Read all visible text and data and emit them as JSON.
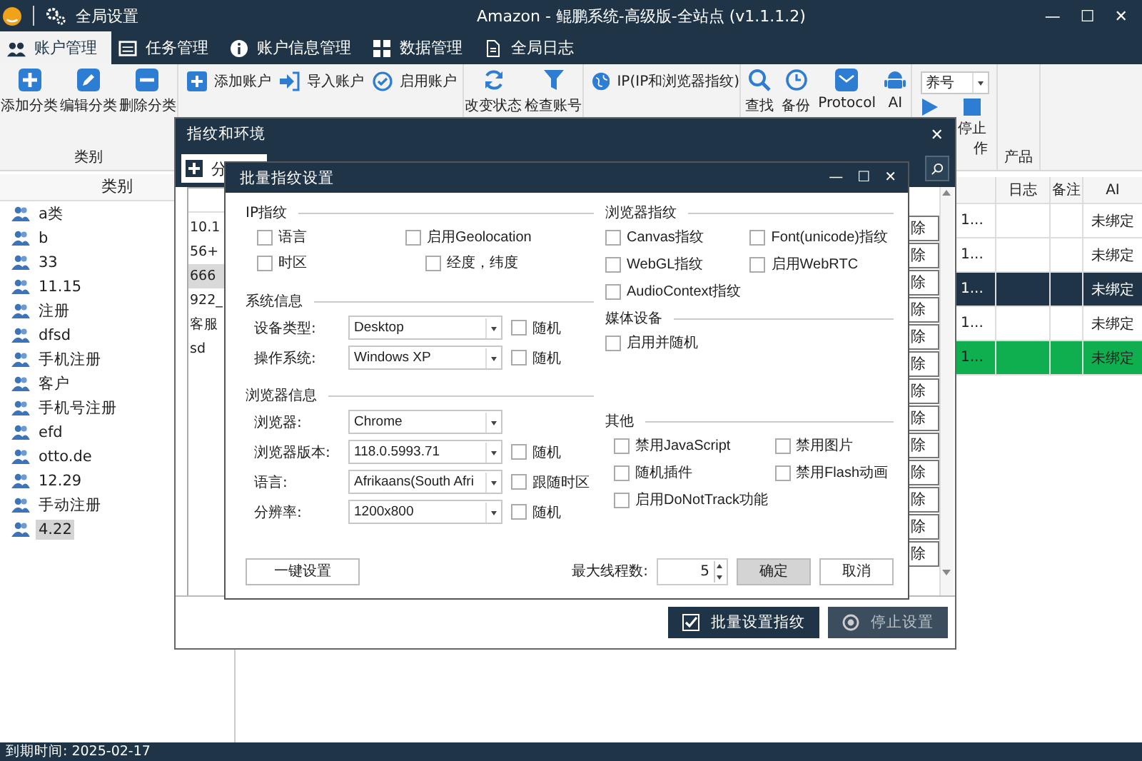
{
  "app": {
    "global_settings": "全局设置",
    "title": "Amazon - 鲲鹏系统-高级版-全站点  (v1.1.1.2)",
    "controls": [
      "—",
      "☐",
      "✕"
    ]
  },
  "tabs": [
    {
      "label": "账户管理",
      "selected": true
    },
    {
      "label": "任务管理",
      "selected": false
    },
    {
      "label": "账户信息管理",
      "selected": false
    },
    {
      "label": "数据管理",
      "selected": false
    },
    {
      "label": "全局日志",
      "selected": false
    }
  ],
  "ribbon": {
    "category_buttons": [
      "添加分类",
      "编辑分类",
      "删除分类"
    ],
    "category_group": "类别",
    "account_buttons": [
      "添加账户",
      "导入账户",
      "启用账户"
    ],
    "status_buttons": [
      "改变状态",
      "检查账号"
    ],
    "ip_button": "IP(IP和浏览器指纹)",
    "tool_buttons": [
      "查找",
      "备份",
      "Protocol",
      "AI"
    ],
    "mode_select": "养号",
    "stop_button": "停止",
    "operate_group": "作",
    "product_group": "产品"
  },
  "categories": {
    "header": "类别",
    "items": [
      {
        "label": "a类",
        "selected": false
      },
      {
        "label": "b",
        "selected": false
      },
      {
        "label": "33",
        "selected": false
      },
      {
        "label": "11.15",
        "selected": false
      },
      {
        "label": "注册",
        "selected": false
      },
      {
        "label": "dfsd",
        "selected": false
      },
      {
        "label": "手机注册",
        "selected": false
      },
      {
        "label": "客户",
        "selected": false
      },
      {
        "label": "手机号注册",
        "selected": false
      },
      {
        "label": "efd",
        "selected": false
      },
      {
        "label": "otto.de",
        "selected": false
      },
      {
        "label": "12.29",
        "selected": false
      },
      {
        "label": "手动注册",
        "selected": false
      },
      {
        "label": "4.22",
        "selected": true
      }
    ]
  },
  "accounts_table": {
    "columns": [
      "日志",
      "备注",
      "AI"
    ],
    "rows": [
      {
        "cell": "1...",
        "ai": "未绑定",
        "selected": false,
        "color": "#ffffff"
      },
      {
        "cell": "1...",
        "ai": "未绑定",
        "selected": false,
        "color": "#ffffff"
      },
      {
        "cell": "1...",
        "ai": "未绑定",
        "selected": true
      },
      {
        "cell": "1...",
        "ai": "未绑定",
        "selected": false,
        "color": "#ffffff"
      },
      {
        "cell": "1...",
        "ai": "未绑定",
        "selected": false,
        "color": "#0fae4f"
      }
    ]
  },
  "fingerprint_dialog": {
    "title": "指纹和环境",
    "close": "✕",
    "toolbar_button": "分",
    "groups": [
      {
        "label": "10.1",
        "selected": false
      },
      {
        "label": "56+",
        "selected": false
      },
      {
        "label": "666",
        "selected": true
      },
      {
        "label": "922_",
        "selected": false
      },
      {
        "label": "客服",
        "selected": false
      },
      {
        "label": "sd",
        "selected": false
      }
    ],
    "delete_buttons": [
      "除",
      "除",
      "除",
      "除",
      "除",
      "除",
      "除",
      "除",
      "除",
      "除",
      "除",
      "除",
      "除"
    ],
    "actions": [
      {
        "label": "批量设置指纹",
        "disabled": false
      },
      {
        "label": "停止设置",
        "disabled": true
      }
    ]
  },
  "batch_dialog": {
    "title": "批量指纹设置",
    "controls": [
      "—",
      "☐",
      "✕"
    ],
    "ip_section": {
      "title": "IP指纹",
      "options": [
        {
          "label": "语言",
          "checked": false
        },
        {
          "label": "启用Geolocation",
          "checked": false
        },
        {
          "label": "时区",
          "checked": false
        },
        {
          "label": "经度，纬度",
          "checked": false
        }
      ]
    },
    "system_section": {
      "title": "系统信息",
      "fields": [
        {
          "label": "设备类型:",
          "value": "Desktop",
          "option": {
            "label": "随机",
            "checked": false
          }
        },
        {
          "label": "操作系统:",
          "value": "Windows XP",
          "option": {
            "label": "随机",
            "checked": false
          }
        }
      ]
    },
    "browser_section": {
      "title": "浏览器信息",
      "fields": [
        {
          "label": "浏览器:",
          "value": "Chrome"
        },
        {
          "label": "浏览器版本:",
          "value": "118.0.5993.71",
          "option": {
            "label": "随机",
            "checked": false
          }
        },
        {
          "label": "语言:",
          "value": "Afrikaans(South Afri",
          "option": {
            "label": "跟随时区",
            "checked": false
          }
        },
        {
          "label": "分辨率:",
          "value": "1200x800",
          "option": {
            "label": "随机",
            "checked": false
          }
        }
      ]
    },
    "fingerprint_section": {
      "title": "浏览器指纹",
      "options": [
        {
          "label": "Canvas指纹",
          "checked": false
        },
        {
          "label": "Font(unicode)指纹",
          "checked": false
        },
        {
          "label": "WebGL指纹",
          "checked": false
        },
        {
          "label": "启用WebRTC",
          "checked": false
        },
        {
          "label": "AudioContext指纹",
          "checked": false
        }
      ]
    },
    "media_section": {
      "title": "媒体设备",
      "options": [
        {
          "label": "启用并随机",
          "checked": false
        }
      ]
    },
    "other_section": {
      "title": "其他",
      "options": [
        {
          "label": "禁用JavaScript",
          "checked": false
        },
        {
          "label": "禁用图片",
          "checked": false
        },
        {
          "label": "随机插件",
          "checked": false
        },
        {
          "label": "禁用Flash动画",
          "checked": false
        },
        {
          "label": "启用DoNotTrack功能",
          "checked": false
        }
      ]
    },
    "one_click_button": "一键设置",
    "threads_label": "最大线程数:",
    "threads_value": "5",
    "ok_button": "确定",
    "cancel_button": "取消"
  },
  "status_bar": {
    "expiry": "到期时间:  2025-02-17"
  }
}
